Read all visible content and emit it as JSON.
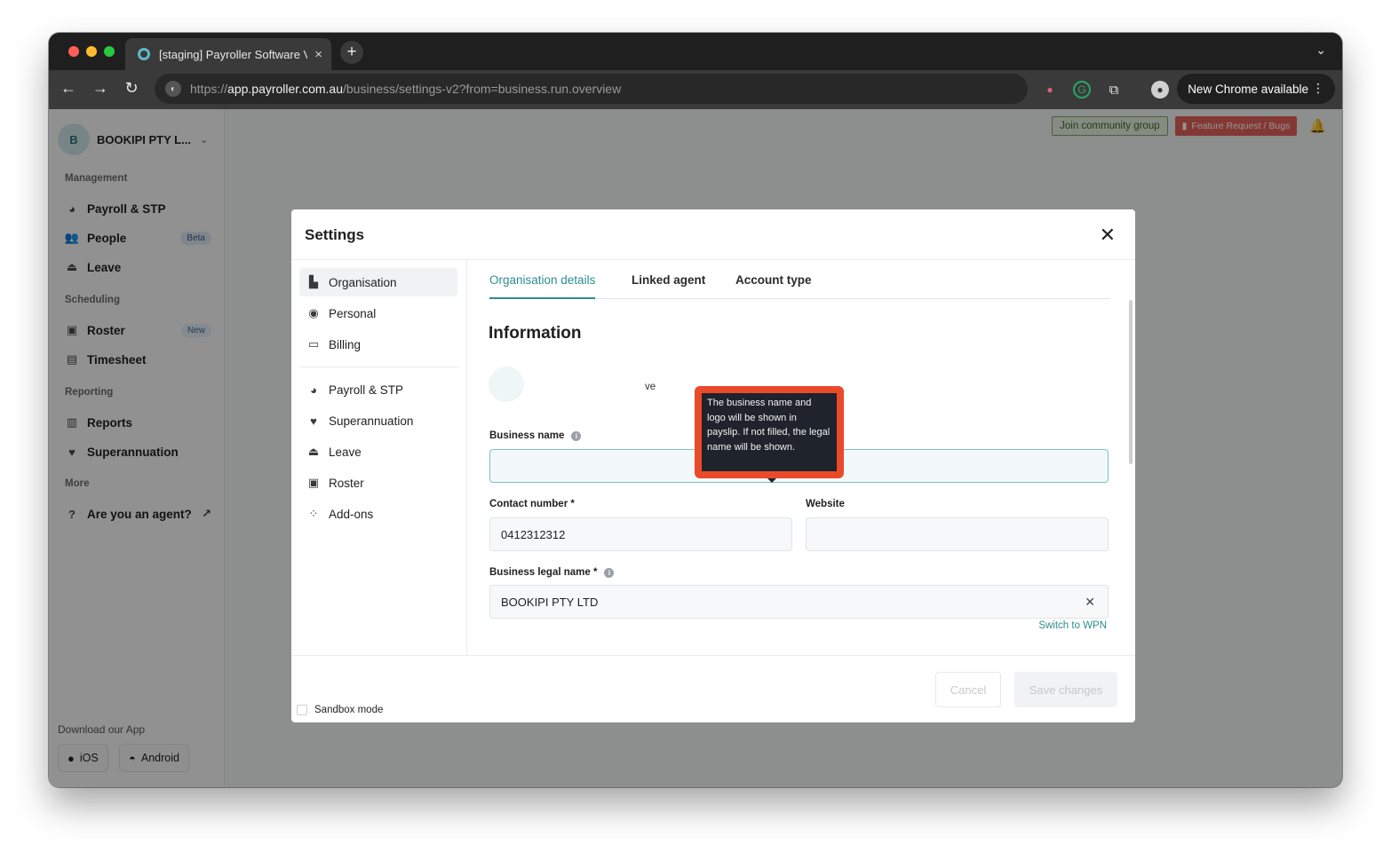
{
  "browser": {
    "tab_title": "[staging] Payroller Software V",
    "tab_close": "×",
    "new_tab": "+",
    "tab_menu": "⌄",
    "url_prefix": "https://",
    "url_host": "app.payroller.com.au",
    "url_path": "/business/settings-v2?from=business.run.overview",
    "new_chrome": "New Chrome available",
    "colors": {
      "frame": "#1f1f1f",
      "toolbar": "#3a3a3a"
    }
  },
  "sidebar": {
    "business_initial": "B",
    "business_name": "BOOKIPI PTY L...",
    "sections": {
      "management": "Management",
      "scheduling": "Scheduling",
      "reporting": "Reporting",
      "more": "More"
    },
    "items": {
      "payroll": "Payroll & STP",
      "people": "People",
      "people_badge": "Beta",
      "leave": "Leave",
      "roster": "Roster",
      "roster_badge": "New",
      "timesheet": "Timesheet",
      "reports": "Reports",
      "superannuation": "Superannuation",
      "agent": "Are you an agent?"
    },
    "download_label": "Download our App",
    "ios": "iOS",
    "android": "Android"
  },
  "topbar": {
    "join": "Join community group",
    "feature": "Feature Request / Bugs"
  },
  "modal": {
    "title": "Settings",
    "side": {
      "organisation": "Organisation",
      "personal": "Personal",
      "billing": "Billing",
      "payroll": "Payroll & STP",
      "superannuation": "Superannuation",
      "leave": "Leave",
      "roster": "Roster",
      "addons": "Add-ons"
    },
    "tabs": {
      "org_details": "Organisation details",
      "linked_agent": "Linked agent",
      "account_type": "Account type"
    },
    "section_heading": "Information",
    "logo_text_fragment": "ve",
    "tooltip": "The business name and logo will be shown in payslip. If not filled, the legal name will be shown.",
    "fields": {
      "business_name_label": "Business name",
      "business_name_value": "",
      "contact_label": "Contact number *",
      "contact_value": "0412312312",
      "website_label": "Website",
      "website_value": "",
      "legal_label": "Business legal name *",
      "legal_value": "BOOKIPI PTY LTD"
    },
    "switch_wpn": "Switch to WPN",
    "sandbox": "Sandbox mode",
    "cancel": "Cancel",
    "save": "Save changes",
    "accent_color": "#2f8c8f"
  }
}
